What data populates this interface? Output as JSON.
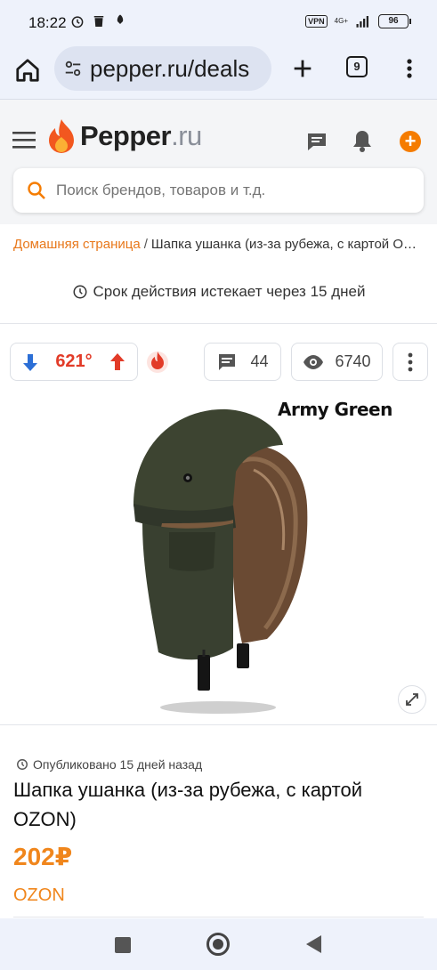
{
  "status": {
    "time": "18:22",
    "vpn": "VPN",
    "network": "4G+",
    "battery": "96"
  },
  "browser": {
    "url": "pepper.ru/deals",
    "tab_count": "9"
  },
  "header": {
    "logo_main": "Pepper",
    "logo_suffix": ".ru",
    "brand_color": "#f57c00"
  },
  "search": {
    "placeholder": "Поиск брендов, товаров и т.д."
  },
  "breadcrumb": {
    "home": "Домашняя страница",
    "separator": "/",
    "current": "Шапка ушанка (из-за рубежа, с картой OZON)"
  },
  "expiry": {
    "text": "Срок действия истекает через 15 дней"
  },
  "deal_stats": {
    "temperature": "621°",
    "comments": "44",
    "views": "6740"
  },
  "image": {
    "caption": "Army Green",
    "icon": "expand-icon"
  },
  "deal": {
    "published": "Опубликовано 15 дней назад",
    "title": "Шапка ушанка (из-за рубежа, с картой OZON)",
    "price": "202₽",
    "merchant": "OZON",
    "price_color": "#f0861c"
  }
}
